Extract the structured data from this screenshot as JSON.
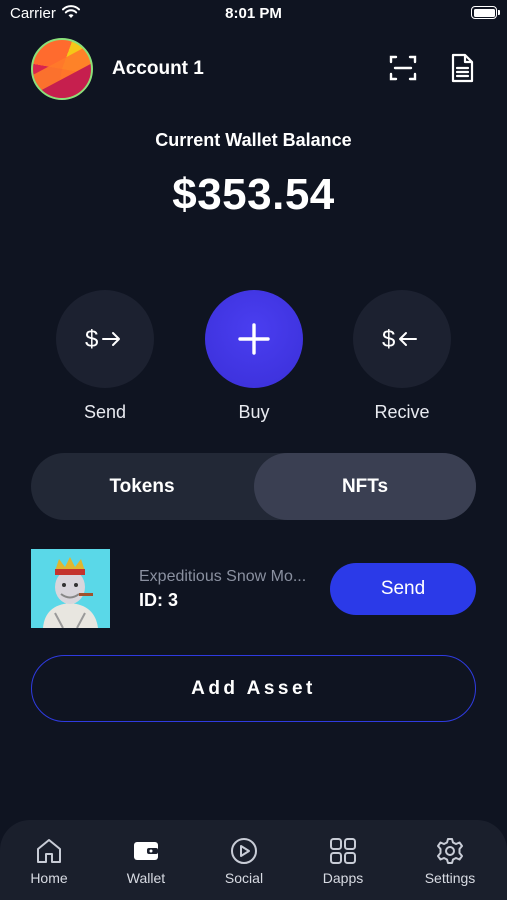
{
  "status_bar": {
    "carrier": "Carrier",
    "time": "8:01 PM"
  },
  "header": {
    "account_name": "Account 1",
    "scan_icon": "scan-icon",
    "document_icon": "document-icon"
  },
  "balance": {
    "label": "Current Wallet Balance",
    "value": "$353.54"
  },
  "actions": [
    {
      "label": "Send",
      "icon": "$→"
    },
    {
      "label": "Buy",
      "icon": "+"
    },
    {
      "label": "Recive",
      "icon": "$←"
    }
  ],
  "tabs": {
    "tokens": "Tokens",
    "nfts": "NFTs",
    "active": "nfts"
  },
  "nft": {
    "name": "Expeditious Snow Mo...",
    "id": "ID: 3",
    "send_label": "Send"
  },
  "add_asset_label": "Add Asset",
  "nav": [
    {
      "label": "Home",
      "icon": "home-icon"
    },
    {
      "label": "Wallet",
      "icon": "wallet-icon"
    },
    {
      "label": "Social",
      "icon": "play-icon"
    },
    {
      "label": "Dapps",
      "icon": "grid-icon"
    },
    {
      "label": "Settings",
      "icon": "gear-icon"
    }
  ],
  "colors": {
    "background": "#0f1421",
    "accent": "#2b3ae8",
    "buy": "#4a3ef0",
    "active_tab": "#3a3f52"
  }
}
